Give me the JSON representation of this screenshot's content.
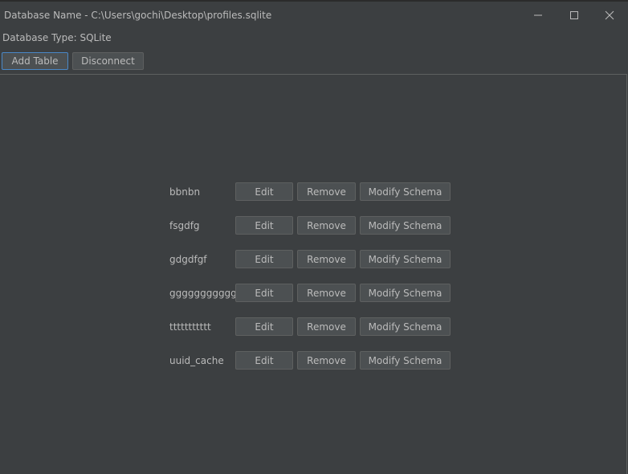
{
  "window": {
    "title": "Database Name - C:\\Users\\gochi\\Desktop\\profiles.sqlite",
    "controls": {
      "minimize_icon": "minimize-icon",
      "maximize_icon": "maximize-icon",
      "close_icon": "close-icon"
    }
  },
  "header": {
    "db_type_label": "Database Type: SQLite"
  },
  "toolbar": {
    "add_table_label": "Add Table",
    "disconnect_label": "Disconnect"
  },
  "tables": [
    {
      "name": "bbnbn",
      "edit_label": "Edit",
      "remove_label": "Remove",
      "modify_label": "Modify Schema"
    },
    {
      "name": "fsgdfg",
      "edit_label": "Edit",
      "remove_label": "Remove",
      "modify_label": "Modify Schema"
    },
    {
      "name": "gdgdfgf",
      "edit_label": "Edit",
      "remove_label": "Remove",
      "modify_label": "Modify Schema"
    },
    {
      "name": "ggggggggggg",
      "edit_label": "Edit",
      "remove_label": "Remove",
      "modify_label": "Modify Schema"
    },
    {
      "name": "ttttttttttt",
      "edit_label": "Edit",
      "remove_label": "Remove",
      "modify_label": "Modify Schema"
    },
    {
      "name": "uuid_cache",
      "edit_label": "Edit",
      "remove_label": "Remove",
      "modify_label": "Modify Schema"
    }
  ],
  "colors": {
    "background": "#3c3f41",
    "button": "#4c5052",
    "button_border": "#5e6060",
    "focus_border": "#4a88c7",
    "text": "#bbbbbb"
  }
}
